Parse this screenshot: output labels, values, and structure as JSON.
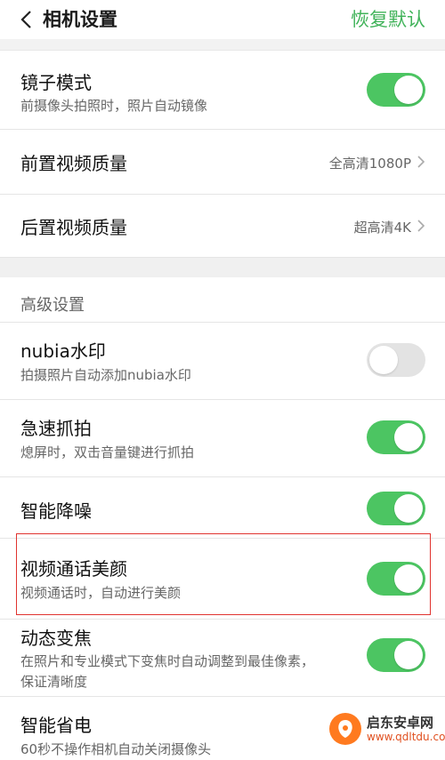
{
  "header": {
    "title": "相机设置",
    "restore_label": "恢复默认"
  },
  "mirror": {
    "title": "镜子模式",
    "subtitle": "前摄像头拍照时，照片自动镜像",
    "enabled": true
  },
  "front_video": {
    "title": "前置视频质量",
    "value": "全高清1080P"
  },
  "rear_video": {
    "title": "后置视频质量",
    "value": "超高清4K"
  },
  "advanced": {
    "section_title": "高级设置"
  },
  "watermark_setting": {
    "title": "nubia水印",
    "subtitle": "拍摄照片自动添加nubia水印",
    "enabled": false
  },
  "quick_snap": {
    "title": "急速抓拍",
    "subtitle": "熄屏时，双击音量键进行抓拍",
    "enabled": true
  },
  "noise_reduction": {
    "title": "智能降噪",
    "enabled": true
  },
  "video_call_beauty": {
    "title": "视频通话美颜",
    "subtitle": "视频通话时，自动进行美颜",
    "enabled": true
  },
  "dynamic_zoom": {
    "title": "动态变焦",
    "subtitle_line1": "在照片和专业模式下变焦时自动调整到最佳像素，",
    "subtitle_line2": "保证清晰度",
    "enabled": true
  },
  "power_saving": {
    "title": "智能省电",
    "subtitle": "60秒不操作相机自动关闭摄像头"
  },
  "site_watermark": {
    "name": "启东安卓网",
    "url": "www.qdltdu.com"
  },
  "colors": {
    "accent": "#41b35a",
    "toggle_on": "#4cc562",
    "toggle_off": "#e3e3e3",
    "highlight": "#e0332f"
  }
}
